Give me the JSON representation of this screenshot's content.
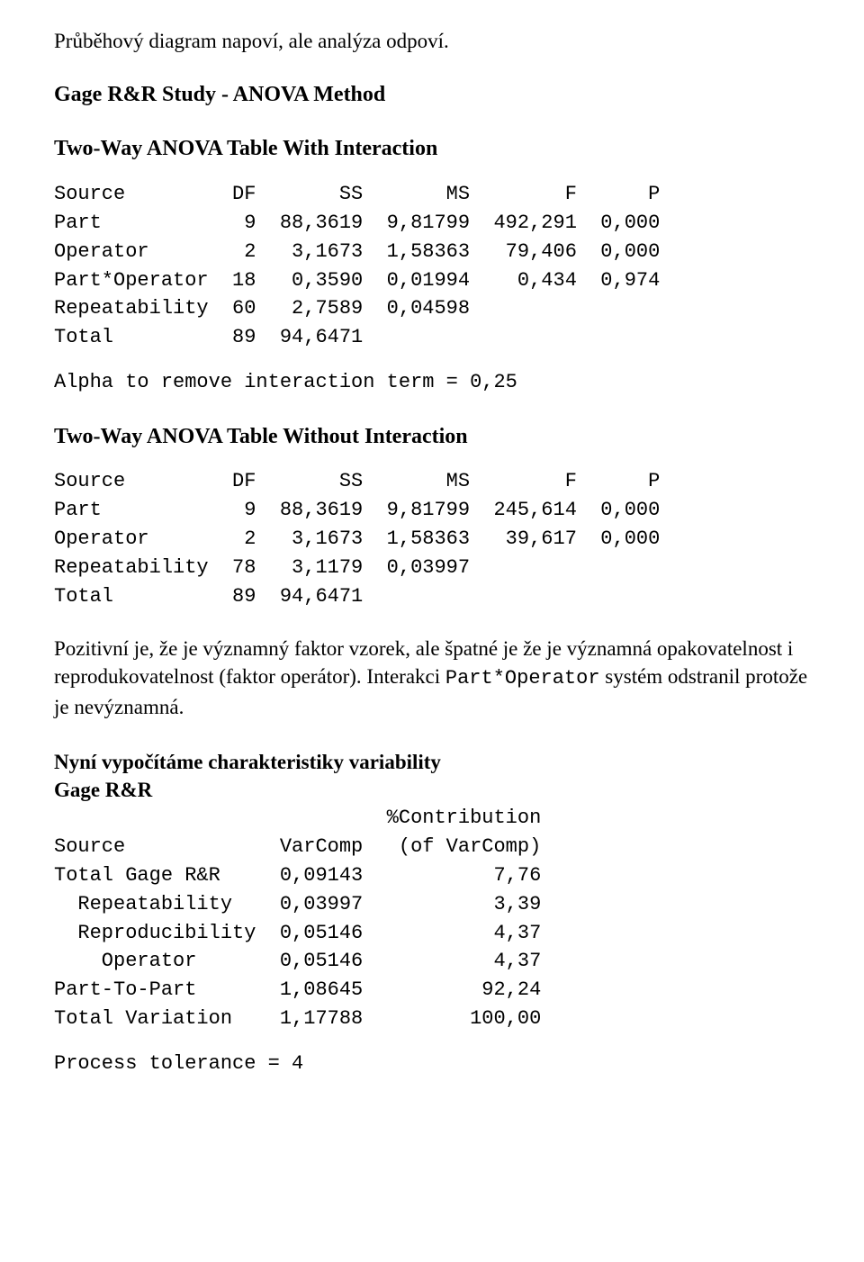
{
  "intro_line": "Průběhový diagram napoví, ale analýza odpoví.",
  "study_title": "Gage R&R Study - ANOVA Method",
  "table1_title": "Two-Way ANOVA Table With Interaction",
  "table1": {
    "header": [
      "Source",
      "DF",
      "SS",
      "MS",
      "F",
      "P"
    ],
    "rows": [
      [
        "Part",
        "9",
        "88,3619",
        "9,81799",
        "492,291",
        "0,000"
      ],
      [
        "Operator",
        "2",
        "3,1673",
        "1,58363",
        "79,406",
        "0,000"
      ],
      [
        "Part*Operator",
        "18",
        "0,3590",
        "0,01994",
        "0,434",
        "0,974"
      ],
      [
        "Repeatability",
        "60",
        "2,7589",
        "0,04598",
        "",
        ""
      ],
      [
        "Total",
        "89",
        "94,6471",
        "",
        "",
        ""
      ]
    ]
  },
  "alpha_line": "Alpha to remove interaction term = 0,25",
  "table2_title": "Two-Way ANOVA Table Without Interaction",
  "table2": {
    "header": [
      "Source",
      "DF",
      "SS",
      "MS",
      "F",
      "P"
    ],
    "rows": [
      [
        "Part",
        "9",
        "88,3619",
        "9,81799",
        "245,614",
        "0,000"
      ],
      [
        "Operator",
        "2",
        "3,1673",
        "1,58363",
        "39,617",
        "0,000"
      ],
      [
        "Repeatability",
        "78",
        "3,1179",
        "0,03997",
        "",
        ""
      ],
      [
        "Total",
        "89",
        "94,6471",
        "",
        "",
        ""
      ]
    ]
  },
  "analysis_line1": "Pozitivní je, že je významný faktor vzorek, ale špatné je že je významná opakovatelnost i reprodukovatelnost (faktor operátor). Interakci ",
  "analysis_code": "Part*Operator",
  "analysis_line2": " systém odstranil protože je nevýznamná.",
  "char_title": "Nyní vypočítáme charakteristiky variability",
  "gage_label": "Gage R&R",
  "table3": {
    "header_line1": [
      "",
      "",
      "%Contribution"
    ],
    "header_line2": [
      "Source",
      "VarComp",
      "(of VarComp)"
    ],
    "rows": [
      [
        "Total Gage R&R",
        "0,09143",
        "7,76"
      ],
      [
        "  Repeatability",
        "0,03997",
        "3,39"
      ],
      [
        "  Reproducibility",
        "0,05146",
        "4,37"
      ],
      [
        "    Operator",
        "0,05146",
        "4,37"
      ],
      [
        "Part-To-Part",
        "1,08645",
        "92,24"
      ],
      [
        "Total Variation",
        "1,17788",
        "100,00"
      ]
    ]
  },
  "tolerance_line": "Process tolerance = 4"
}
